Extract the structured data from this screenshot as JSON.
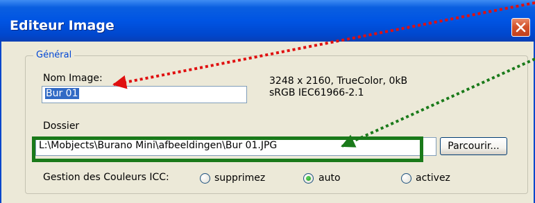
{
  "window": {
    "title": "Editeur Image",
    "close_icon": "close-icon"
  },
  "general": {
    "legend": "Général",
    "name_label": "Nom Image:",
    "name_value": "Bur 01",
    "info_line1": "3248 x 2160, TrueColor, 0kB",
    "info_line2": "sRGB IEC61966-2.1",
    "folder_label": "Dossier",
    "folder_value": "L:\\Mobjects\\Burano Mini\\afbeeldingen\\Bur 01.JPG",
    "browse_label": "Parcourir...",
    "icc_label": "Gestion des Couleurs ICC:",
    "icc_options": [
      {
        "label": "supprimez",
        "selected": false
      },
      {
        "label": "auto",
        "selected": true
      },
      {
        "label": "activez",
        "selected": false
      }
    ]
  },
  "annotations": {
    "red_arrow_color": "#e01010",
    "green_arrow_color": "#1a7a1a"
  }
}
